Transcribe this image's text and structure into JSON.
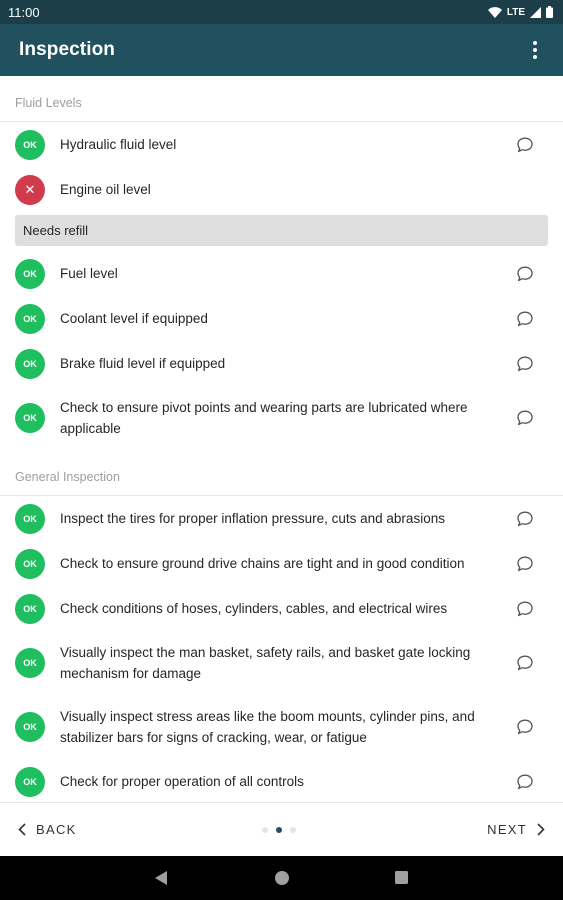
{
  "status_bar": {
    "time": "11:00",
    "network": "LTE"
  },
  "app_bar": {
    "title": "Inspection",
    "menu_icon": "more-vert-icon"
  },
  "colors": {
    "app_bar": "#21505e",
    "status_bar": "#1b3e48",
    "ok": "#1fbe5f",
    "fail": "#d23b4d"
  },
  "sections": [
    {
      "title": "Fluid Levels",
      "items": [
        {
          "status": "OK",
          "text": "Hydraulic fluid level",
          "has_comment_icon": true
        },
        {
          "status": "X",
          "text": "Engine oil level",
          "has_comment_icon": false,
          "note": "Needs refill"
        },
        {
          "status": "OK",
          "text": "Fuel level",
          "has_comment_icon": true
        },
        {
          "status": "OK",
          "text": "Coolant level if equipped",
          "has_comment_icon": true
        },
        {
          "status": "OK",
          "text": "Brake fluid level if equipped",
          "has_comment_icon": true
        },
        {
          "status": "OK",
          "text": "Check to ensure pivot points and wearing parts are lubricated where applicable",
          "has_comment_icon": true
        }
      ]
    },
    {
      "title": "General Inspection",
      "items": [
        {
          "status": "OK",
          "text": "Inspect the tires for proper inflation pressure, cuts and abrasions",
          "has_comment_icon": true
        },
        {
          "status": "OK",
          "text": "Check to ensure ground drive chains are tight and in good condition",
          "has_comment_icon": true
        },
        {
          "status": "OK",
          "text": "Check conditions of hoses, cylinders, cables, and electrical wires",
          "has_comment_icon": true
        },
        {
          "status": "OK",
          "text": "Visually inspect the man basket, safety rails, and basket gate locking mechanism for damage",
          "has_comment_icon": true
        },
        {
          "status": "OK",
          "text": "Visually inspect stress areas like the boom mounts, cylinder pins, and stabilizer bars for signs of cracking, wear, or fatigue",
          "has_comment_icon": true
        },
        {
          "status": "OK",
          "text": "Check for proper operation of all controls",
          "has_comment_icon": true
        }
      ]
    }
  ],
  "bottom_nav": {
    "back_label": "BACK",
    "next_label": "NEXT",
    "page_count": 3,
    "current_page": 2
  }
}
